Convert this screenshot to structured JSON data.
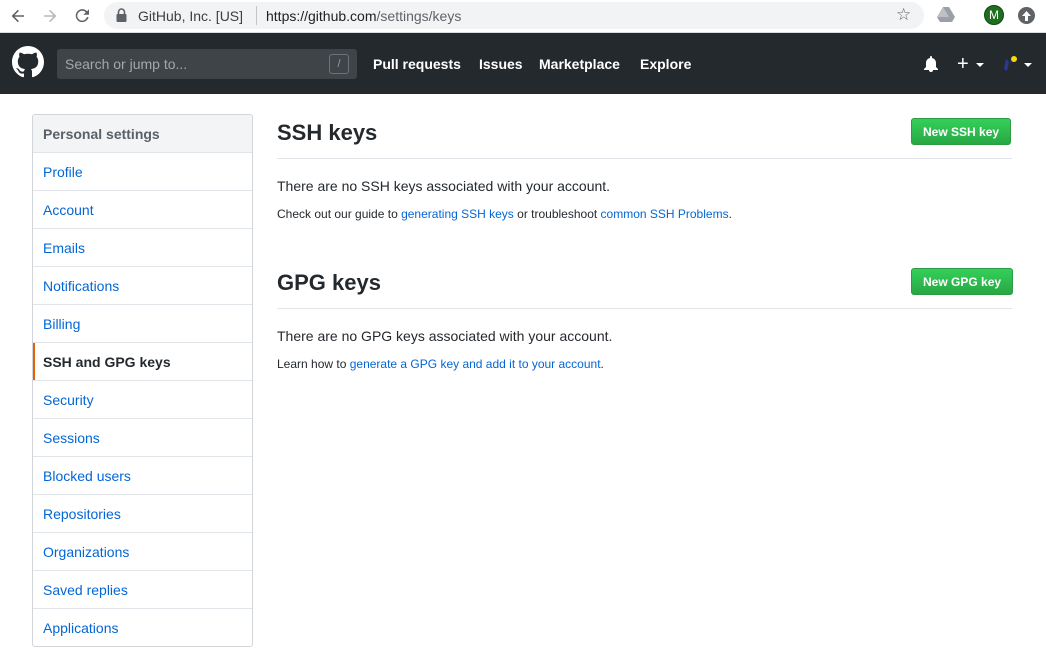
{
  "browser": {
    "site_identity": "GitHub, Inc. [US]",
    "url_host": "https://github.com",
    "url_path": "/settings/keys",
    "profile_initial": "M"
  },
  "header": {
    "search_placeholder": "Search or jump to...",
    "search_shortcut": "/",
    "nav": [
      "Pull requests",
      "Issues",
      "Marketplace",
      "Explore"
    ],
    "plus": "+"
  },
  "sidebar": {
    "heading": "Personal settings",
    "items": [
      {
        "label": "Profile"
      },
      {
        "label": "Account"
      },
      {
        "label": "Emails"
      },
      {
        "label": "Notifications"
      },
      {
        "label": "Billing"
      },
      {
        "label": "SSH and GPG keys",
        "selected": true
      },
      {
        "label": "Security"
      },
      {
        "label": "Sessions"
      },
      {
        "label": "Blocked users"
      },
      {
        "label": "Repositories"
      },
      {
        "label": "Organizations"
      },
      {
        "label": "Saved replies"
      },
      {
        "label": "Applications"
      }
    ]
  },
  "ssh": {
    "title": "SSH keys",
    "button": "New SSH key",
    "empty": "There are no SSH keys associated with your account.",
    "note_prefix": "Check out our guide to ",
    "link1": "generating SSH keys",
    "note_mid": " or troubleshoot ",
    "link2": "common SSH Problems",
    "note_suffix": "."
  },
  "gpg": {
    "title": "GPG keys",
    "button": "New GPG key",
    "empty": "There are no GPG keys associated with your account.",
    "note_prefix": "Learn how to ",
    "link": "generate a GPG key and add it to your account",
    "note_suffix": "."
  },
  "colors": {
    "header_bg": "#24292e",
    "link": "#0366d6",
    "button_green": "#28a745",
    "selected_accent": "#e36209"
  }
}
